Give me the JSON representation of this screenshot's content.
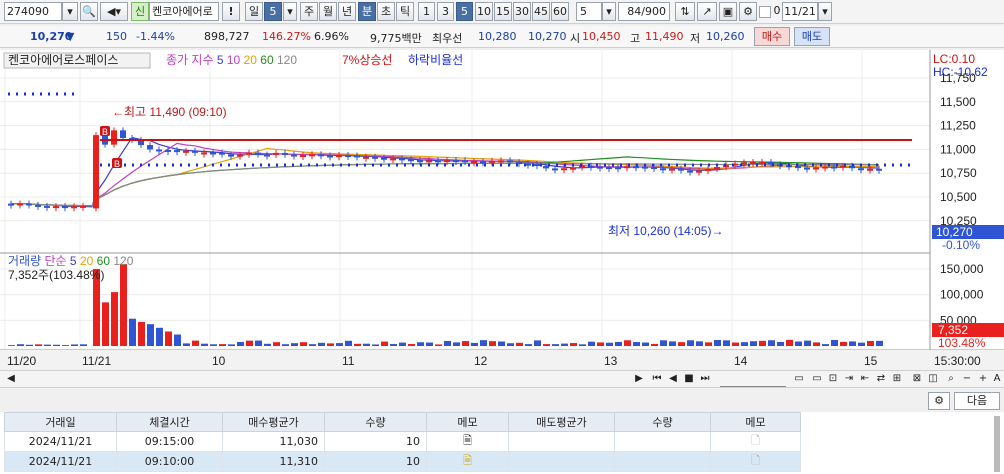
{
  "toolbar": {
    "code": "274090",
    "name": "켄코아에어로",
    "sin_badge": "신",
    "alert": "!",
    "period_il": "일",
    "period_num": "5",
    "ju": "주",
    "wol": "월",
    "nyeon": "년",
    "bun": "분",
    "cho": "초",
    "tik": "틱",
    "min1": "1",
    "min3": "3",
    "min5": "5",
    "min10": "10",
    "min15": "15",
    "min30": "30",
    "min45": "45",
    "min60": "60",
    "interval": "5",
    "count": "84/900",
    "date": "11/21",
    "checkbox_label": "0"
  },
  "info": {
    "price": "10,270",
    "arrow": "▼",
    "change": "150",
    "change_pct": "-1.44%",
    "volume": "898,727",
    "vol_ratio": "146.27%",
    "turnover": "6.96%",
    "amount": "9,775백만",
    "best_ask_label": "최우선",
    "best_ask": "10,280",
    "best_bid": "10,270",
    "open_label": "시",
    "open": "10,450",
    "high_label": "고",
    "high": "11,490",
    "low_label": "저",
    "low": "10,260",
    "buy_label": "매수",
    "sell_label": "매도"
  },
  "chart": {
    "stock_label": "켄코아에어로스페이스",
    "ma_legend_label": "종가 지수",
    "ma_periods": [
      "5",
      "10",
      "20",
      "60",
      "120"
    ],
    "upper_limit_label": "7%상승선",
    "lower_label": "하락비율선",
    "lc": "LC:0.10",
    "hc": "HC:-10.62",
    "price_ticks": [
      "11,750",
      "11,500",
      "11,250",
      "11,000",
      "10,750",
      "10,500",
      "10,250"
    ],
    "high_annotation": "최고 11,490 (09:10)",
    "low_annotation": "최저 10,260 (14:05)",
    "marker_b": "B",
    "current_price": "10,270",
    "current_pct": "-0.10%",
    "vol_label": "거래량",
    "vol_ma_label": "단순",
    "vol_ma_periods": [
      "5",
      "20",
      "60",
      "120"
    ],
    "vol_value": "7,352주(103.48%)",
    "vol_ticks": [
      "150,000",
      "100,000",
      "50,000"
    ],
    "vol_current": "7,352",
    "vol_pct": "103.48%",
    "x_labels": [
      "11/20",
      "11/21",
      "10",
      "11",
      "12",
      "13",
      "14",
      "15"
    ],
    "time_label": "15:30:00",
    "colors": {
      "up": "#e8201e",
      "down": "#2f55d4",
      "ma5": "#3b3bcf",
      "ma10": "#c040c0",
      "ma20": "#e8a000",
      "ma60": "#209020",
      "ma120": "#888888",
      "limit": "#d01010",
      "dots": "#1a2ed8"
    }
  },
  "grid": {
    "next_label": "다음",
    "headers": [
      "거래일",
      "체결시간",
      "매수평균가",
      "수량",
      "메모",
      "매도평균가",
      "수량",
      "메모"
    ],
    "rows": [
      {
        "date": "2024/11/21",
        "time": "09:15:00",
        "price": "11,030",
        "qty": "10"
      },
      {
        "date": "2024/11/21",
        "time": "09:10:00",
        "price": "11,310",
        "qty": "10"
      }
    ]
  }
}
